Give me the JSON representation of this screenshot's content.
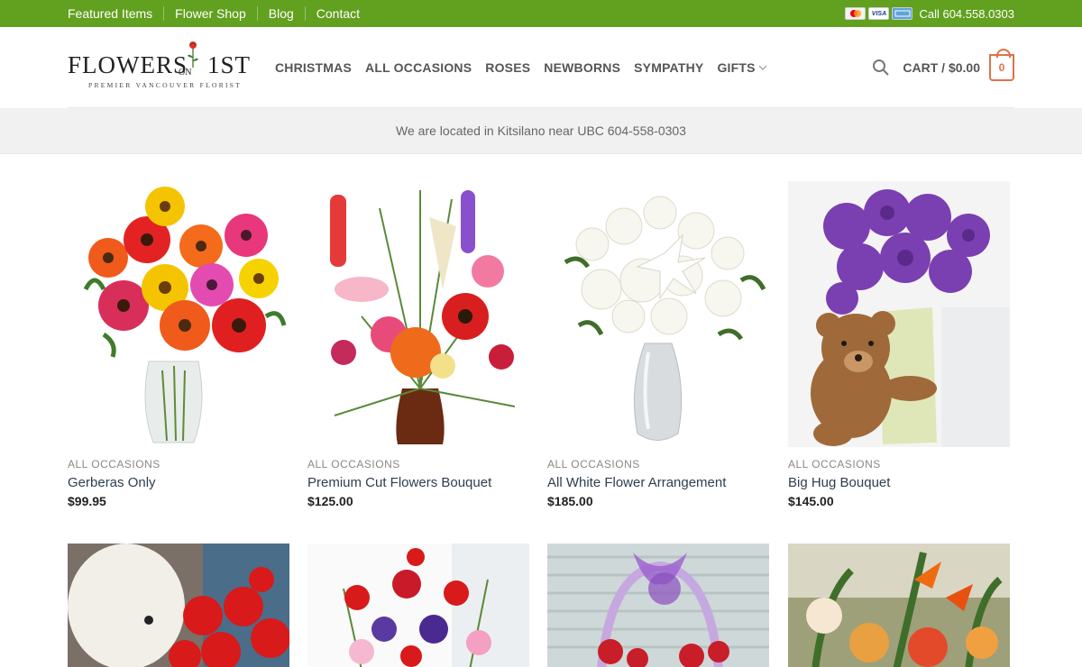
{
  "topbar": {
    "links": [
      "Featured Items",
      "Flower Shop",
      "Blog",
      "Contact"
    ],
    "cards": [
      "MC",
      "VISA",
      "AMEX"
    ],
    "phone": "Call 604.558.0303"
  },
  "logo": {
    "name": "FLOWERS",
    "on": "ON",
    "first": "1ST",
    "tagline": "PREMIER VANCOUVER FLORIST"
  },
  "nav": {
    "items": [
      "CHRISTMAS",
      "ALL OCCASIONS",
      "ROSES",
      "NEWBORNS",
      "SYMPATHY",
      "GIFTS"
    ]
  },
  "cart": {
    "label": "CART / $0.00",
    "count": "0"
  },
  "notice": "We are located in Kitsilano near UBC 604-558-0303",
  "products": [
    {
      "category": "ALL OCCASIONS",
      "title": "Gerberas Only",
      "price": "$99.95"
    },
    {
      "category": "ALL OCCASIONS",
      "title": "Premium Cut Flowers Bouquet",
      "price": "$125.00"
    },
    {
      "category": "ALL OCCASIONS",
      "title": "All White Flower Arrangement",
      "price": "$185.00"
    },
    {
      "category": "ALL OCCASIONS",
      "title": "Big Hug Bouquet",
      "price": "$145.00"
    }
  ],
  "colors": {
    "topbar": "#62a01f",
    "accent": "#e0714a",
    "link": "#2d3e50"
  }
}
